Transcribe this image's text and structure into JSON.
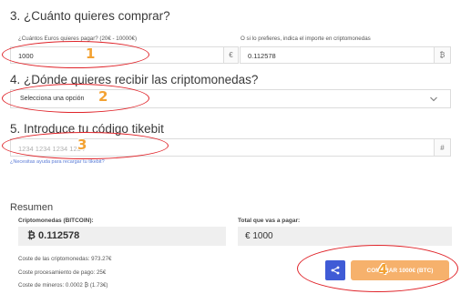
{
  "step3": {
    "heading": "3. ¿Cuánto quieres comprar?",
    "eur_label": "¿Cuántos Euros quieres pagar? (20€ - 10000€)",
    "eur_value": "1000",
    "eur_suffix": "€",
    "crypto_label": "O si lo prefieres, indica el importe en criptomonedas",
    "crypto_value": "0.112578",
    "crypto_suffix": "₿",
    "marker": "1"
  },
  "step4": {
    "heading": "4. ¿Dónde quieres recibir las criptomonedas?",
    "select_value": "Selecciona una opción",
    "marker": "2"
  },
  "step5": {
    "heading": "5. Introduce tu código tikebit",
    "code_placeholder": "1234 1234 1234 1234",
    "code_suffix": "#",
    "help_link": "¿Necesitas ayuda para recargar tu tikebit?",
    "marker": "3"
  },
  "summary": {
    "heading": "Resumen",
    "crypto_label": "Criptomonedas (BITCOIN):",
    "crypto_value": "₿ 0.112578",
    "total_label": "Total que vas a pagar:",
    "total_value": "€ 1000",
    "cost_crypto": "Coste de las criptomonedas: 973.27€",
    "cost_processing": "Coste procesamiento de pago: 25€",
    "cost_miners": "Coste de mineros: 0.0002 ₿ (1.73€)",
    "buy_label": "COMPRAR 1000€ (BTC)",
    "marker": "4"
  }
}
